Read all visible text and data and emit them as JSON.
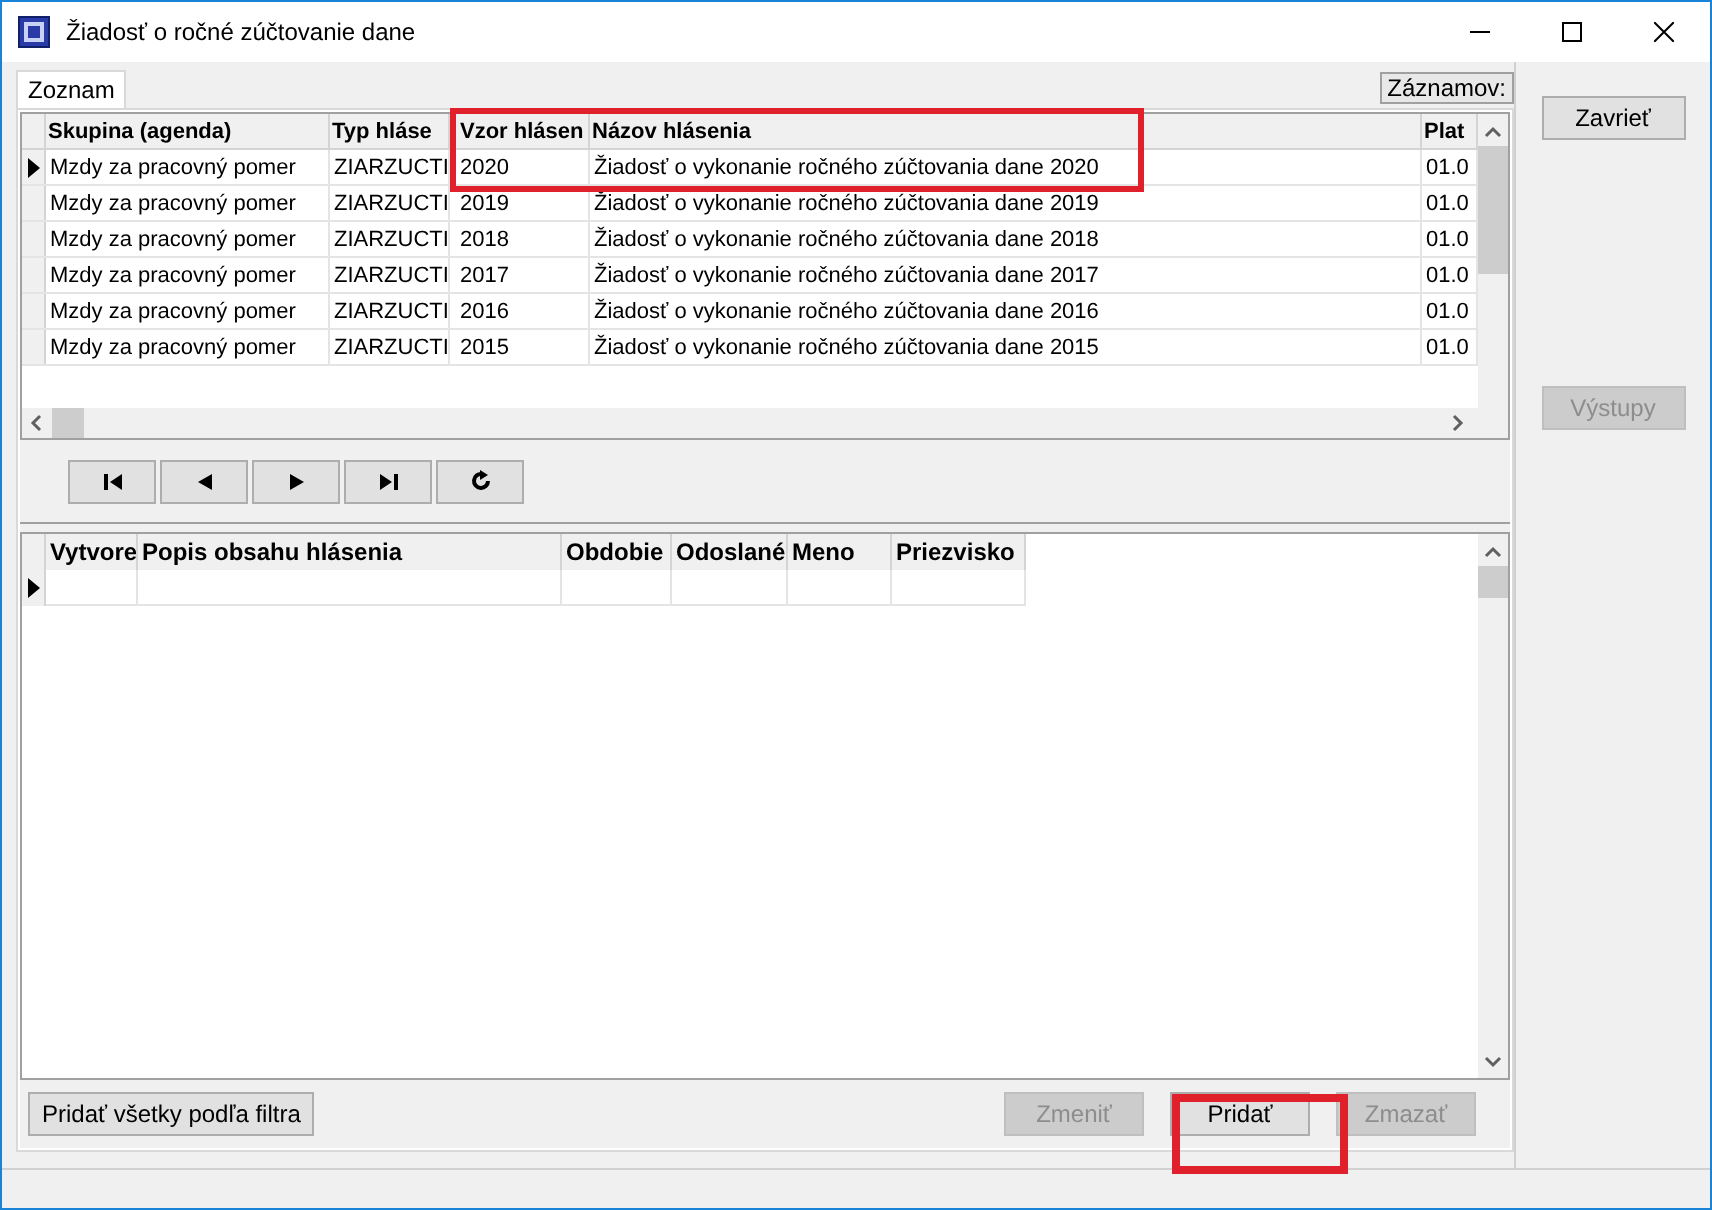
{
  "window": {
    "title": "Žiadosť o ročné zúčtovanie dane"
  },
  "tabs": [
    {
      "label": "Zoznam",
      "selected": true
    }
  ],
  "records_label": "Záznamov:",
  "top_table": {
    "columns": [
      "Skupina (agenda)",
      "Typ hláse",
      "Vzor hlásen",
      "Názov hlásenia",
      "Plat"
    ],
    "rows": [
      {
        "selected": true,
        "cells": [
          "Mzdy za pracovný pomer",
          "ZIARZUCTI",
          "2020",
          "Žiadosť o vykonanie ročného zúčtovania dane 2020",
          "01.0"
        ]
      },
      {
        "selected": false,
        "cells": [
          "Mzdy za pracovný pomer",
          "ZIARZUCTI",
          "2019",
          "Žiadosť o vykonanie ročného zúčtovania dane 2019",
          "01.0"
        ]
      },
      {
        "selected": false,
        "cells": [
          "Mzdy za pracovný pomer",
          "ZIARZUCTI",
          "2018",
          "Žiadosť o vykonanie ročného zúčtovania dane 2018",
          "01.0"
        ]
      },
      {
        "selected": false,
        "cells": [
          "Mzdy za pracovný pomer",
          "ZIARZUCTI",
          "2017",
          "Žiadosť o vykonanie ročného zúčtovania dane 2017",
          "01.0"
        ]
      },
      {
        "selected": false,
        "cells": [
          "Mzdy za pracovný pomer",
          "ZIARZUCTI",
          "2016",
          "Žiadosť o vykonanie ročného zúčtovania dane 2016",
          "01.0"
        ]
      },
      {
        "selected": false,
        "cells": [
          "Mzdy za pracovný pomer",
          "ZIARZUCTI",
          "2015",
          "Žiadosť o vykonanie ročného zúčtovania dane 2015",
          "01.0"
        ]
      }
    ]
  },
  "navigator": [
    {
      "kind": "first"
    },
    {
      "kind": "prev"
    },
    {
      "kind": "next"
    },
    {
      "kind": "last"
    },
    {
      "kind": "refresh"
    }
  ],
  "bottom_table": {
    "columns": [
      "Vytvore",
      "Popis obsahu hlásenia",
      "Obdobie",
      "Odoslané",
      "Meno",
      "Priezvisko"
    ],
    "rows": [
      {
        "selected": true
      }
    ]
  },
  "side_buttons": [
    {
      "label": "Zavrieť",
      "disabled": false
    },
    {
      "label": "Výstupy",
      "disabled": true
    }
  ],
  "bottom_buttons": [
    {
      "label": "Pridať všetky podľa filtra",
      "disabled": false
    },
    {
      "label": "Zmeniť",
      "disabled": true
    },
    {
      "label": "Pridať",
      "disabled": false
    },
    {
      "label": "Zmazať",
      "disabled": true
    }
  ]
}
